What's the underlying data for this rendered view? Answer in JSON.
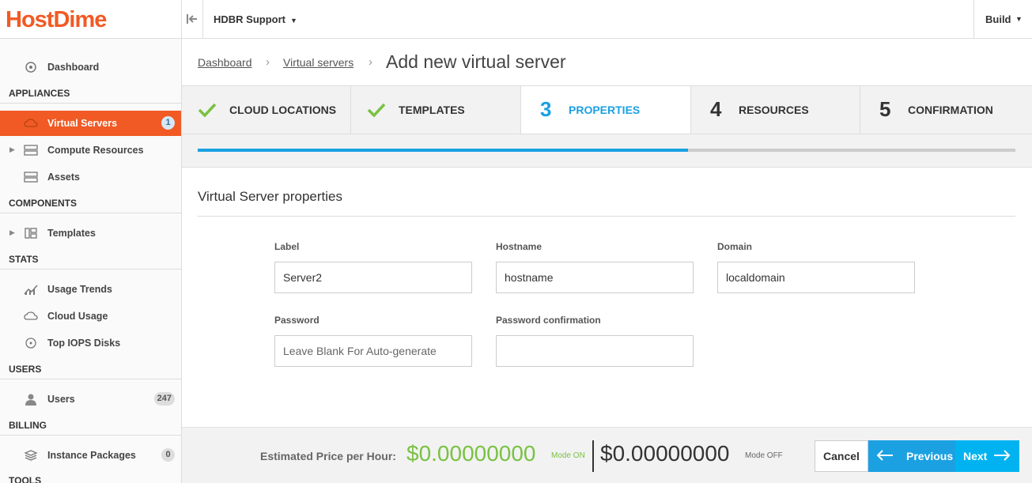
{
  "brand": {
    "logo": "HostDime",
    "accent": "#f15a24"
  },
  "header": {
    "org": "HDBR Support",
    "build": "Build"
  },
  "sidebar": {
    "dashboard": "Dashboard",
    "sections": {
      "appliances": "APPLIANCES",
      "components": "COMPONENTS",
      "stats": "STATS",
      "users": "USERS",
      "billing": "BILLING",
      "tools": "TOOLS"
    },
    "items": {
      "virtual_servers": {
        "label": "Virtual Servers",
        "badge": "1"
      },
      "compute_resources": {
        "label": "Compute Resources"
      },
      "assets": {
        "label": "Assets"
      },
      "templates": {
        "label": "Templates"
      },
      "usage_trends": {
        "label": "Usage Trends"
      },
      "cloud_usage": {
        "label": "Cloud Usage"
      },
      "top_iops": {
        "label": "Top IOPS Disks"
      },
      "users": {
        "label": "Users",
        "badge": "247"
      },
      "instance_packages": {
        "label": "Instance Packages",
        "badge": "0"
      }
    }
  },
  "breadcrumb": {
    "home": "Dashboard",
    "section": "Virtual servers",
    "current": "Add new virtual server"
  },
  "wizard": {
    "steps": [
      {
        "num": "",
        "name": "CLOUD LOCATIONS",
        "state": "done"
      },
      {
        "num": "",
        "name": "TEMPLATES",
        "state": "done"
      },
      {
        "num": "3",
        "name": "PROPERTIES",
        "state": "current"
      },
      {
        "num": "4",
        "name": "RESOURCES",
        "state": "pending"
      },
      {
        "num": "5",
        "name": "CONFIRMATION",
        "state": "pending"
      }
    ],
    "progress": 0.6
  },
  "form": {
    "title": "Virtual Server properties",
    "label": {
      "label": "Label",
      "value": "Server2"
    },
    "hostname": {
      "label": "Hostname",
      "value": "hostname"
    },
    "domain": {
      "label": "Domain",
      "value": "localdomain"
    },
    "password": {
      "label": "Password",
      "placeholder": "Leave Blank For Auto-generate"
    },
    "password_confirm": {
      "label": "Password confirmation",
      "value": ""
    }
  },
  "footer": {
    "price_label": "Estimated Price per Hour:",
    "price_on": "$0.00000000",
    "mode_on": "Mode ON",
    "price_off": "$0.00000000",
    "mode_off": "Mode OFF",
    "cancel": "Cancel",
    "previous": "Previous",
    "next": "Next"
  }
}
